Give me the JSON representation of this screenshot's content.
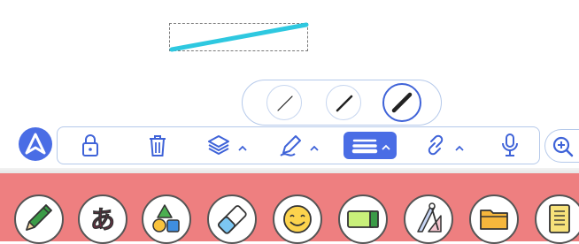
{
  "canvas": {
    "stroke_color": "#2ec8e0",
    "selection": "selected-stroke"
  },
  "width_popup": {
    "options": [
      "thin",
      "medium",
      "thick"
    ],
    "selected": "thick",
    "accent": "#3f63d8"
  },
  "toolbar": {
    "accent": "#4a6de5",
    "border": "#b5c9ea",
    "items": [
      {
        "icon": "lock-icon"
      },
      {
        "icon": "trash-icon"
      },
      {
        "icon": "layers-icon",
        "has_menu": true
      },
      {
        "icon": "pen-settings-icon",
        "has_menu": true
      },
      {
        "icon": "line-width-icon",
        "has_menu": true,
        "active": true
      },
      {
        "icon": "link-icon",
        "has_menu": true
      },
      {
        "icon": "microphone-icon"
      }
    ],
    "zoom_icon": "zoom-in-icon"
  },
  "tray": {
    "background": "#ee7f80",
    "tools": [
      {
        "icon": "pencil-icon",
        "color": "#2e8b3a"
      },
      {
        "icon": "text-icon",
        "label": "あ",
        "color": "#e0245e"
      },
      {
        "icon": "shapes-icon"
      },
      {
        "icon": "eraser-icon"
      },
      {
        "icon": "stamp-icon"
      },
      {
        "icon": "marker-icon"
      },
      {
        "icon": "ruler-compass-icon"
      },
      {
        "icon": "folder-icon"
      },
      {
        "icon": "notebook-icon"
      }
    ]
  }
}
